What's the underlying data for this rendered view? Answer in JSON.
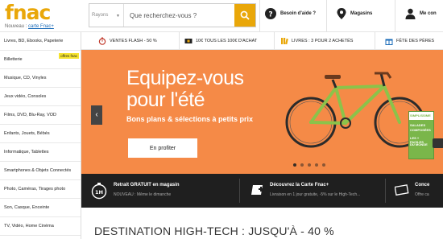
{
  "colors": {
    "brand": "#e9a709",
    "hero_bg": "#f58a47",
    "services_bg": "#1f1f1f"
  },
  "header": {
    "logo": "fnac",
    "logo_sub": "Nouveau :",
    "logo_sub_link": "carte Fnac+",
    "search": {
      "category": "Rayons",
      "placeholder": "Que recherchez-vous ?"
    },
    "help": "Besoin d'aide ?",
    "stores": "Magasins",
    "account": "Me con"
  },
  "promo_bar": [
    {
      "icon": "stopwatch-icon",
      "label": "VENTES FLASH - 50 %"
    },
    {
      "icon": "voucher-icon",
      "label": "10€ TOUS LES 100€ D'ACHAT"
    },
    {
      "icon": "books-icon",
      "label": "LIVRES : 3 POUR 2 ACHETÉS"
    },
    {
      "icon": "gift-icon",
      "label": "FÊTE DES PÈRES"
    }
  ],
  "sidebar": {
    "items": [
      "Livres, BD, Ebooks, Papeterie",
      "Billetterie",
      "Musique, CD, Vinyles",
      "Jeux vidéo, Consoles",
      "Films, DVD, Blu-Ray, VOD",
      "Enfants, Jouets, Bébés",
      "Informatique, Tablettes",
      "Smartphones & Objets Connectés",
      "Photo, Caméras, Tirages photo",
      "Son, Casque, Enceinte",
      "TV, Vidéo, Home Cinéma"
    ],
    "badge": "offres fnac"
  },
  "hero": {
    "title_line1": "Equipez-vous",
    "title_line2": "pour l'été",
    "subtitle": "Bons plans & sélections à petits prix",
    "button": "En profiter",
    "prev_arrow": "‹",
    "book_lines": [
      "SIMPLISSIME",
      "SALADES",
      "COMPOSÉES",
      "LES + FACILES",
      "DU MONDE"
    ]
  },
  "services": [
    {
      "title": "Retrait GRATUIT en magasin",
      "desc": "NOUVEAU : Même le dimanche",
      "icon_text": "1H"
    },
    {
      "title": "Découvrez la Carte Fnac+",
      "desc": "Livraison en 1 jour gratuite, -5% sur le High-Tech..."
    },
    {
      "title": "Conce",
      "desc": "Offre ca"
    }
  ],
  "main": {
    "section_title": "DESTINATION HIGH-TECH : JUSQU'À - 40 %"
  }
}
